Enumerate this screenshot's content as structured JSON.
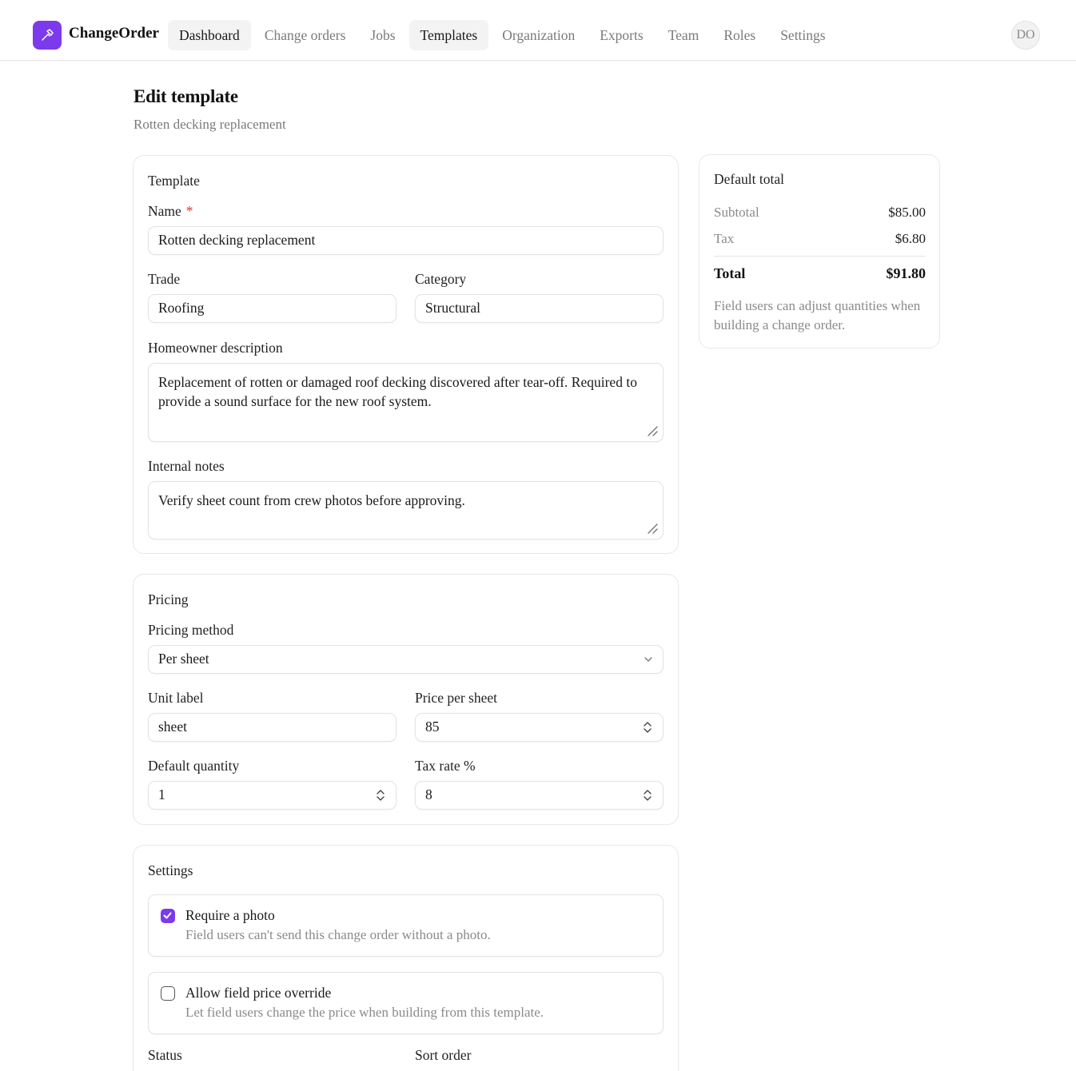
{
  "app": {
    "brand": "ChangeOrder",
    "avatar_initials": "DO",
    "accent_color": "#7c3aed"
  },
  "nav": {
    "items": [
      {
        "label": "Dashboard",
        "active": true
      },
      {
        "label": "Change orders",
        "active": false
      },
      {
        "label": "Jobs",
        "active": false
      },
      {
        "label": "Templates",
        "active": true
      },
      {
        "label": "Organization",
        "active": false
      },
      {
        "label": "Exports",
        "active": false
      },
      {
        "label": "Team",
        "active": false
      },
      {
        "label": "Roles",
        "active": false
      },
      {
        "label": "Settings",
        "active": false
      }
    ]
  },
  "header": {
    "title": "Edit template",
    "subtitle": "Rotten decking replacement"
  },
  "template_card": {
    "title": "Template",
    "name_label": "Name",
    "required_mark": "*",
    "name_value": "Rotten decking replacement",
    "trade_label": "Trade",
    "trade_value": "Roofing",
    "category_label": "Category",
    "category_value": "Structural",
    "description_label": "Homeowner description",
    "description_value": "Replacement of rotten or damaged roof decking discovered after tear-off. Required to provide a sound surface for the new roof system.",
    "notes_label": "Internal notes",
    "notes_value": "Verify sheet count from crew photos before approving."
  },
  "pricing_card": {
    "title": "Pricing",
    "method_label": "Pricing method",
    "method_value": "Per sheet",
    "unit_label": "Unit label",
    "unit_value": "sheet",
    "price_label": "Price per sheet",
    "price_value": "85",
    "qty_label": "Default quantity",
    "qty_value": "1",
    "tax_label": "Tax rate %",
    "tax_value": "8"
  },
  "settings_card": {
    "title": "Settings",
    "options": [
      {
        "title": "Require a photo",
        "desc": "Field users can't send this change order without a photo.",
        "checked": true
      },
      {
        "title": "Allow field price override",
        "desc": "Let field users change the price when building from this template.",
        "checked": false
      }
    ],
    "status_label": "Status",
    "sort_label": "Sort order"
  },
  "summary": {
    "title": "Default total",
    "subtotal_label": "Subtotal",
    "subtotal_value": "$85.00",
    "tax_label": "Tax",
    "tax_value": "$6.80",
    "total_label": "Total",
    "total_value": "$91.80",
    "note": "Field users can adjust quantities when building a change order."
  }
}
